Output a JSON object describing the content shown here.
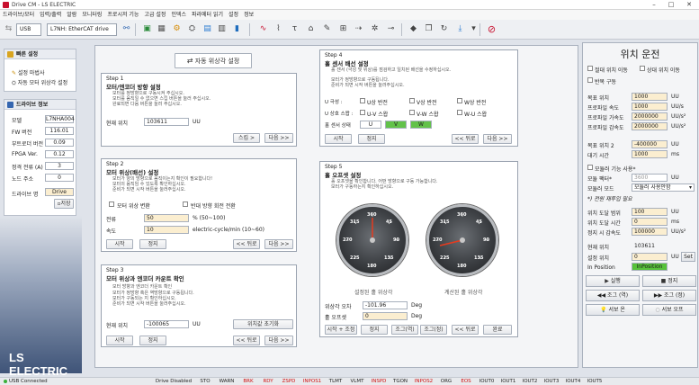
{
  "window": {
    "title": "Drive CM - LS ELECTRIC"
  },
  "menu": [
    "드라이브/모터",
    "입력/출력",
    "알람",
    "모니터링",
    "프로시저 기능",
    "고급 설정",
    "인덱스",
    "파라메터 읽기",
    "설정",
    "정보"
  ],
  "toolbar": {
    "connection": "USB",
    "drive": "L7NH: EtherCAT drive"
  },
  "left_quick": {
    "title": "빠른 설정",
    "items": [
      "설정 마법사",
      "자동 모터 위상각 설정"
    ]
  },
  "drive_info": {
    "title": "드라이브 정보",
    "fields": [
      {
        "label": "모델",
        "value": "L7NHA004"
      },
      {
        "label": "FW 버전",
        "value": "116.01"
      },
      {
        "label": "부트로더 버전",
        "value": "0.09"
      },
      {
        "label": "FPGA Ver.",
        "value": "0.12"
      },
      {
        "label": "정격 전류 (A)",
        "value": "3"
      },
      {
        "label": "노드 주소",
        "value": "0"
      }
    ],
    "name_label": "드라이브 명",
    "name_value": "Drive",
    "save": "저장"
  },
  "main": {
    "title": "자동 위상각 설정",
    "step1": {
      "title": "Step 1",
      "heading": "모터/엔코더 방향 설정",
      "desc": [
        "모터를 정방향으로 구동시켜 주십시오.",
        "모터를 움직일 수 없으면 스킵 버튼을 눌러 주십시오.",
        "완료되면 다음 버튼을 눌러 주십시오."
      ],
      "pos_label": "현재 위치",
      "pos_value": "103611",
      "pos_unit": "UU",
      "skip": "스킵 >",
      "next": "다음 >>"
    },
    "step2": {
      "title": "Step 2",
      "heading": "모터 위상(배선) 설정",
      "desc": [
        "모터가 양의 방향으로 움직이는지 확인이 필요합니다!",
        "모터의 움직임 수 있도록 확인하십시오.",
        "준비가 되면 시작 버튼을 눌러주십시오."
      ],
      "chk1": "모터 위상 변환",
      "chk2": "반대 방향 회전 전환",
      "current_label": "전류",
      "current_value": "50",
      "current_unit": "% (50~100)",
      "speed_label": "속도",
      "speed_value": "10",
      "speed_unit": "electric-cycle/min (10~60)",
      "start": "시작",
      "stop": "정지",
      "back": "<< 뒤로",
      "next": "다음 >>"
    },
    "step3": {
      "title": "Step 3",
      "heading": "모터 위상과 엔코더 카운트 확인",
      "desc": [
        "모터 방향과 엔코더 카운트 확인",
        "모터가 정방향 혹은 역방향으로 구동됩니다.",
        "모터가 구동되는 지 확인하십시오.",
        "준비가 되면 시작 버튼을 눌러주십시오."
      ],
      "pos_label": "현재 위치",
      "pos_value": "-100065",
      "pos_unit": "UU",
      "reset": "위치값 초기화",
      "start": "시작",
      "stop": "정지",
      "back": "<< 뒤로",
      "next": "다음 >>"
    },
    "step4": {
      "title": "Step 4",
      "heading": "홀 센서 배선 설정",
      "desc": [
        "홀 센서 (극성 및 위상)를 점검하고 일치된 배선을 수정하십시오.",
        "모터가 정방향으로 구동됩니다.",
        "준비가 되면 시작 버튼을 눌러주십시오."
      ],
      "row1_label": "U 극성 :",
      "row2_label": "U 상호 스왑 :",
      "opts1": [
        "U상 반전",
        "V상 반전",
        "W상 반전"
      ],
      "opts2": [
        "U-V 스왑",
        "V-W 스왑",
        "W-U 스왑"
      ],
      "state_label": "홀 센서 상태",
      "state": [
        "U",
        "V",
        "W"
      ],
      "start": "시작",
      "stop": "정지",
      "back": "<< 뒤로",
      "next": "다음 >>"
    },
    "step5": {
      "title": "Step 5",
      "heading": "홀 오프셋 설정",
      "desc": [
        "홀 오프셋을 확인합니다. 어떤 방향으로 구동 가능합니다.",
        "모터가 구동하는지 확인하십시오."
      ],
      "gauge1_caption": "설정된 홀 위상각",
      "gauge2_caption": "계산된 홀 위상각",
      "err_label": "위상각 오차",
      "err_value": "-101.96",
      "err_unit": "Deg",
      "offset_label": "홀 오프셋",
      "offset_value": "0",
      "offset_unit": "Deg",
      "start": "시작 + 조정",
      "stop": "정지",
      "adj1": "조그(역)",
      "adj2": "조그(정)",
      "back": "<< 뒤로",
      "done": "완료",
      "ticks": [
        "360",
        "45",
        "90",
        "135",
        "180",
        "225",
        "270",
        "315"
      ]
    }
  },
  "right": {
    "title": "위치 운전",
    "chk_abs": "절대 위치 이동",
    "chk_rel": "상대 위치 이동",
    "chk_repeat": "반복 구동",
    "fields1": [
      {
        "label": "목표 위치",
        "value": "1000",
        "unit": "UU"
      },
      {
        "label": "프로파일 속도",
        "value": "1000",
        "unit": "UU/s"
      },
      {
        "label": "프로파일 가속도",
        "value": "2000000",
        "unit": "UU/s²"
      },
      {
        "label": "프로파일 감속도",
        "value": "2000000",
        "unit": "UU/s²"
      }
    ],
    "fields2": [
      {
        "label": "목표 위치 2",
        "value": "-400000",
        "unit": "UU"
      },
      {
        "label": "대기 시간",
        "value": "1000",
        "unit": "ms"
      }
    ],
    "chk_mode": "모듈러 기능 사용*",
    "modular_factor_label": "모듈 팩터*",
    "modular_factor_value": "3600",
    "modular_factor_unit": "UU",
    "modular_mode_label": "모듈러 모드",
    "modular_mode_value": "모듈러 사용안함",
    "note": "*) 전원 재투입 필요",
    "fields3": [
      {
        "label": "위치 도달 범위",
        "value": "100",
        "unit": "UU"
      },
      {
        "label": "위치 도달 시간",
        "value": "0",
        "unit": "ms"
      },
      {
        "label": "정지 시 감속도",
        "value": "100000",
        "unit": "UU/s²"
      }
    ],
    "cur_pos_label": "현재 위치",
    "cur_pos_value": "103611",
    "set_pos_label": "설정 위치",
    "set_pos_value": "0",
    "set_pos_unit": "UU",
    "set_btn": "Set",
    "in_pos_label": "In Position",
    "in_pos_value": "InPosition",
    "run": "실행",
    "stop": "정지",
    "jog_rev": "조그 (역)",
    "jog_fwd": "조그 (정)",
    "servo_on": "서보 온",
    "servo_off": "서보 오프"
  },
  "status": {
    "conn": "USB Connected",
    "items": [
      "Drive Disabled",
      "STO",
      "WARN",
      "BRK",
      "RDY",
      "ZSPD",
      "INPOS1",
      "TLMT",
      "VLMT",
      "INSPD",
      "TGON",
      "INPOS2",
      "ORG",
      "EOS",
      "IOUT0",
      "IOUT1",
      "IOUT2",
      "IOUT3",
      "IOUT4",
      "IOUT5"
    ]
  },
  "brand": "LS ELECTRIC",
  "colors": {
    "accent": "#c8102e",
    "in_pos": "#56c23a",
    "state_on": "#62c24a",
    "input_yellow": "#fbeed0"
  }
}
